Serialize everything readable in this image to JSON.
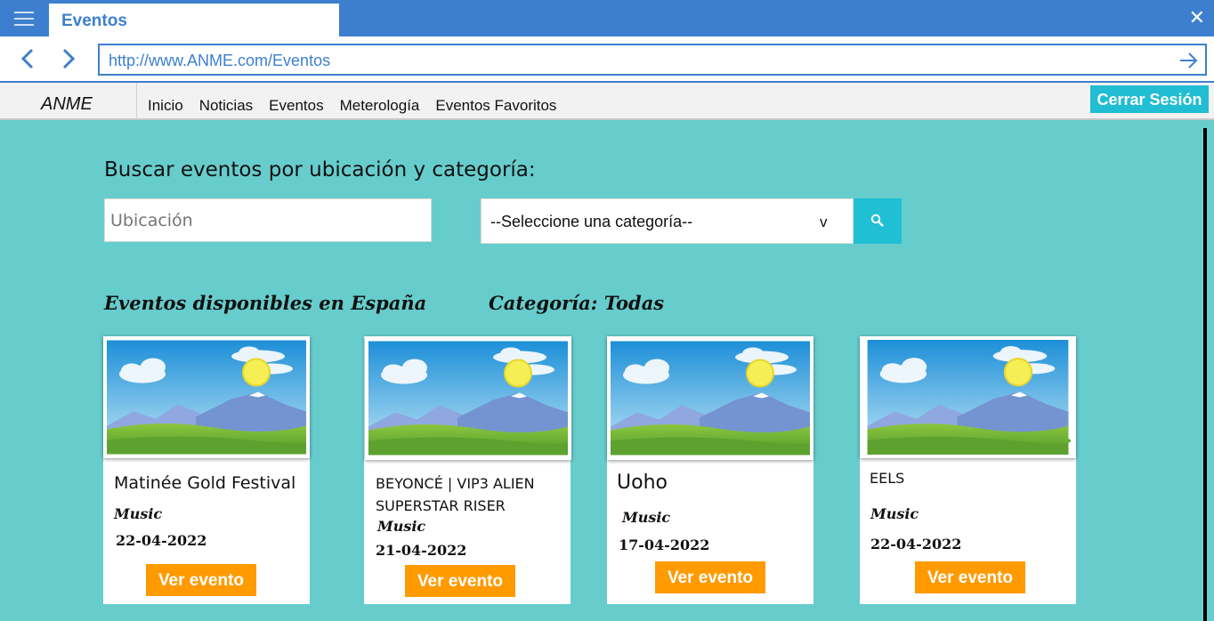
{
  "browser": {
    "tab_title": "Eventos",
    "url": "http://www.ANME.com/Eventos"
  },
  "app": {
    "brand": "ANME",
    "nav": [
      "Inicio",
      "Noticias",
      "Eventos",
      "Meterología",
      "Eventos Favoritos"
    ],
    "logout_label": "Cerrar Sesión"
  },
  "search": {
    "heading": "Buscar eventos por ubicación y categoría:",
    "location_placeholder": "Ubicación",
    "category_selected": "--Seleccione una categoría--",
    "caret": "v"
  },
  "results": {
    "available_label": "Eventos disponibles en España",
    "category_label": "Categoría: Todas"
  },
  "events": [
    {
      "title": "Matinée Gold Festival",
      "category": "Music",
      "date": "22-04-2022",
      "button": "Ver evento"
    },
    {
      "title": "BEYONCÉ | VIP3 ALIEN SUPERSTAR RISER",
      "category": "Music",
      "date": "21-04-2022",
      "button": "Ver evento"
    },
    {
      "title": "Uoho",
      "category": "Music",
      "date": "17-04-2022",
      "button": "Ver evento"
    },
    {
      "title": "EELS",
      "category": "Music",
      "date": "22-04-2022",
      "button": "Ver evento"
    }
  ],
  "colors": {
    "browser_blue": "#3d7fce",
    "background": "#67cdcc",
    "accent_cyan": "#20bdd3",
    "button_orange": "#ff9a00"
  },
  "icons": [
    "menu-icon",
    "close-icon",
    "back-arrow-icon",
    "forward-arrow-icon",
    "go-arrow-icon",
    "search-icon",
    "landscape-image-icon"
  ]
}
